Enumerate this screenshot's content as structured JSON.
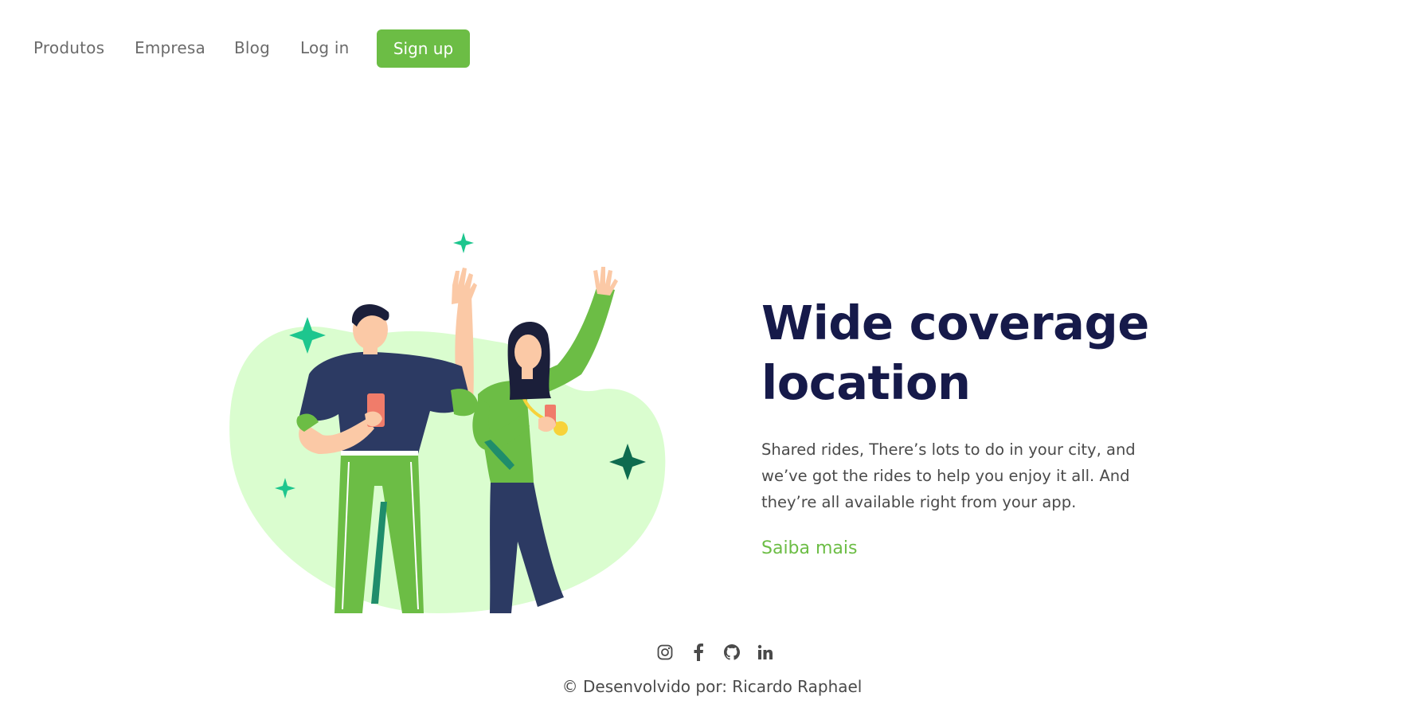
{
  "nav": {
    "links": [
      "Produtos",
      "Empresa",
      "Blog",
      "Log in"
    ],
    "signup_label": "Sign up"
  },
  "hero": {
    "title_line1": "Wide coverage",
    "title_line2": "location",
    "description": "Shared rides, There’s lots to do in your city, and we’ve got the rides to help you enjoy it all. And they’re all available right from your app.",
    "cta_label": "Saiba mais"
  },
  "social": {
    "icons": [
      "instagram-icon",
      "facebook-icon",
      "github-icon",
      "linkedin-icon"
    ]
  },
  "footer": {
    "credit": "© Desenvolvido por: Ricardo Raphael"
  },
  "colors": {
    "accent": "#6cbd45",
    "headline": "#161a4a",
    "text": "#4a4a4a",
    "nav_text": "#6b6b6b",
    "blob": "#dafdcf",
    "sparkle": "#1dc68e",
    "sparkle_dark": "#0e6b4f",
    "navy": "#2c3a63",
    "skin": "#fbc9a6"
  }
}
